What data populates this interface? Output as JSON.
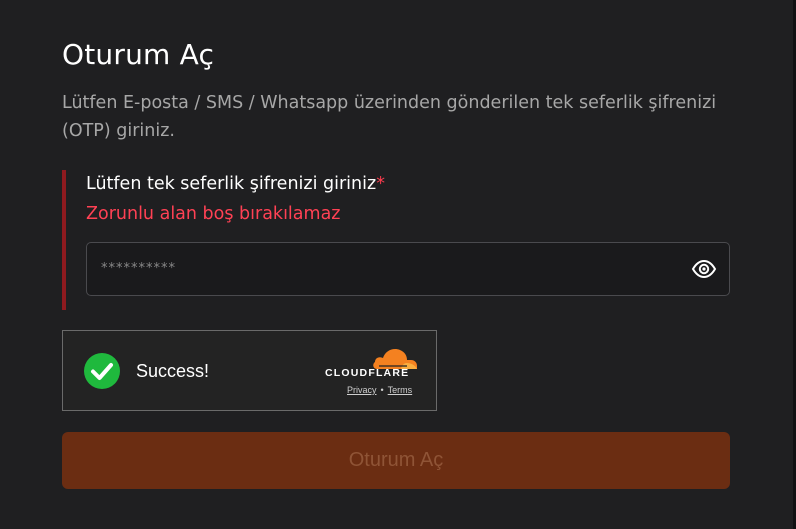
{
  "form": {
    "title": "Oturum Aç",
    "subtitle": "Lütfen E-posta / SMS / Whatsapp üzerinden gönderilen tek seferlik şifrenizi (OTP) giriniz.",
    "otp_field": {
      "label": "Lütfen tek seferlik şifrenizi giriniz",
      "required_mark": "*",
      "error": "Zorunlu alan boş bırakılamaz",
      "placeholder": "**********",
      "toggle_icon": "eye-icon"
    },
    "submit_label": "Oturum Aç"
  },
  "captcha": {
    "status_icon": "check-circle-icon",
    "status": "Success!",
    "brand": "CLOUDFLARE",
    "privacy_link": "Privacy",
    "separator": "•",
    "terms_link": "Terms"
  },
  "colors": {
    "background": "#1f1f21",
    "error": "#ff4154",
    "error_bar": "#8e1a1f",
    "submit_bg": "#6b2d12",
    "success_green": "#1fb93d",
    "cloudflare_orange": "#f48120"
  }
}
